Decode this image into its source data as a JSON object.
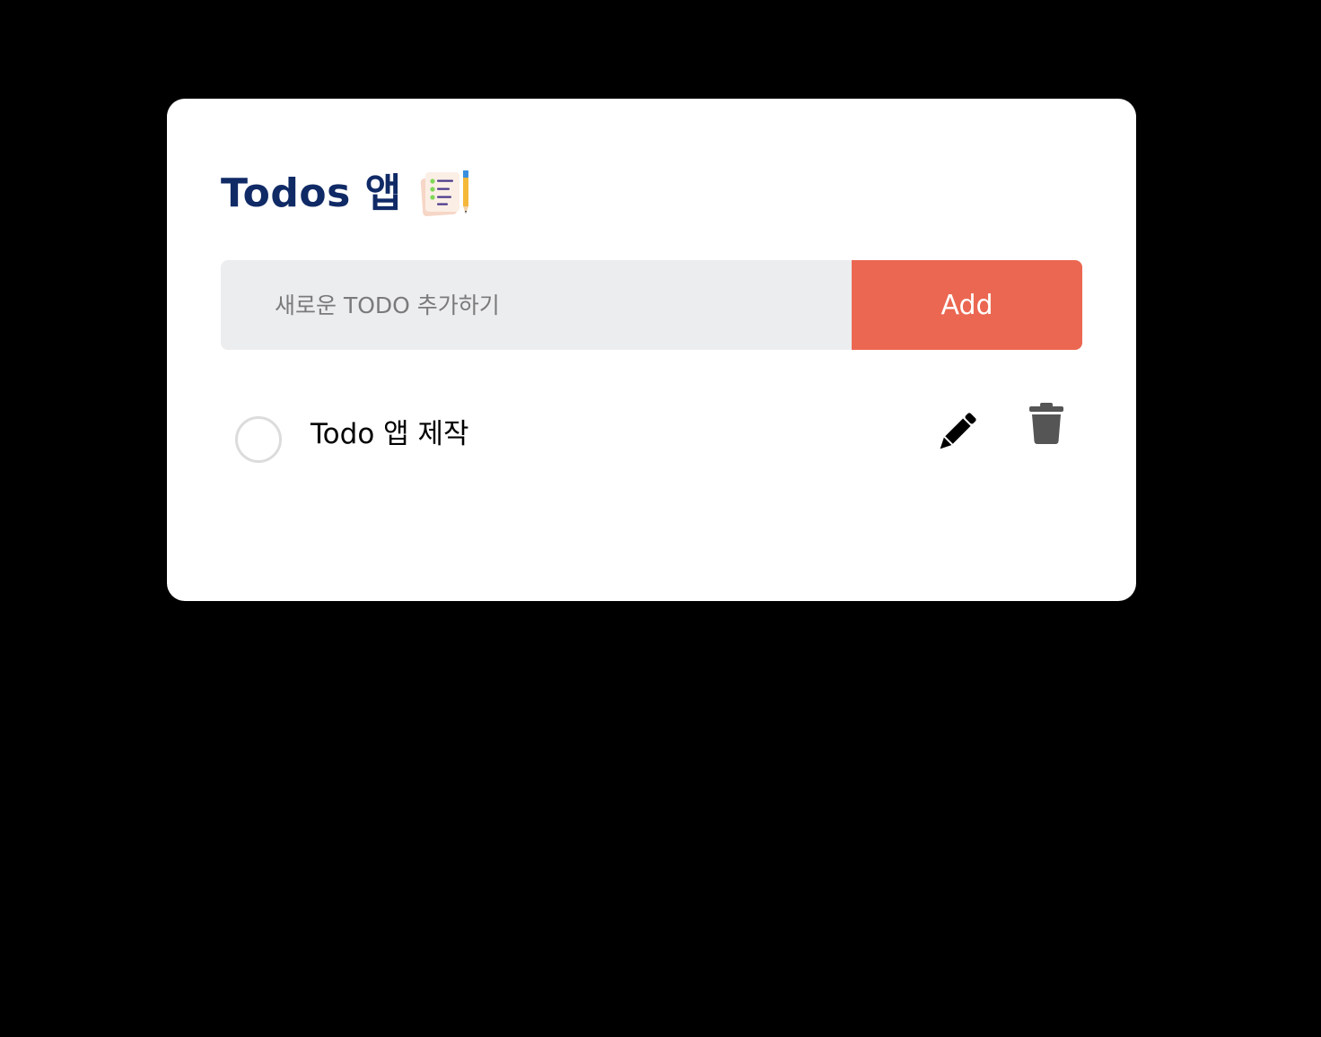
{
  "app": {
    "title": "Todos 앱",
    "title_icon": "memo-pencil-icon"
  },
  "add_form": {
    "placeholder": "새로운 TODO 추가하기",
    "value": "",
    "button_label": "Add"
  },
  "todos": [
    {
      "text": "Todo 앱 제작",
      "completed": false
    }
  ],
  "colors": {
    "background": "#000000",
    "card": "#ffffff",
    "title": "#102a66",
    "input_bg": "#ecedef",
    "accent": "#eb6751",
    "checkbox_border": "#dcdcdc",
    "trash": "#555555"
  },
  "icons": {
    "edit": "pencil-icon",
    "delete": "trash-icon"
  }
}
